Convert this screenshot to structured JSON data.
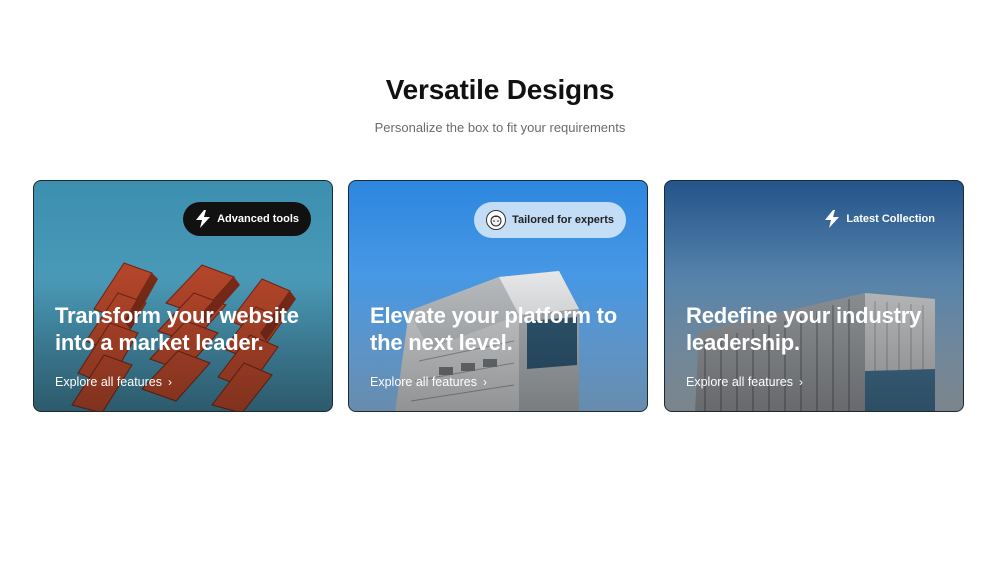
{
  "section": {
    "title": "Versatile Designs",
    "subtitle": "Personalize the box to fit your requirements"
  },
  "cards": [
    {
      "badge": "Advanced tools",
      "badge_icon": "lightning-icon",
      "headline": "Transform your website into a market leader.",
      "link": "Explore all features"
    },
    {
      "badge": "Tailored for experts",
      "badge_icon": "avatar-icon",
      "headline": "Elevate your platform to the next level.",
      "link": "Explore all features"
    },
    {
      "badge": "Latest Collection",
      "badge_icon": "lightning-icon",
      "headline": "Redefine your industry leadership.",
      "link": "Explore all features"
    }
  ],
  "colors": {
    "text": "#111111",
    "subtitle": "#6b6b6b",
    "badge_dark": "#111111",
    "white": "#ffffff"
  }
}
